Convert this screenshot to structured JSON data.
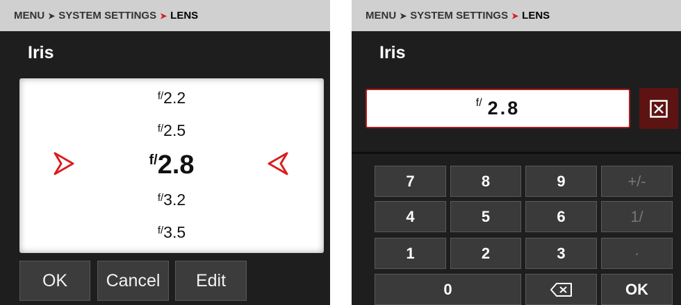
{
  "left": {
    "breadcrumb": {
      "menu": "MENU",
      "section": "SYSTEM SETTINGS",
      "current": "LENS"
    },
    "title": "Iris",
    "wheel": {
      "prefix": "f/",
      "items": [
        "2.2",
        "2.5",
        "2.8",
        "3.2",
        "3.5"
      ],
      "selected_index": 2
    },
    "buttons": {
      "ok": "OK",
      "cancel": "Cancel",
      "edit": "Edit"
    }
  },
  "right": {
    "breadcrumb": {
      "menu": "MENU",
      "section": "SYSTEM SETTINGS",
      "current": "LENS"
    },
    "title": "Iris",
    "field": {
      "prefix": "f/",
      "value": "2.8"
    },
    "clear_icon": "close-box-icon",
    "keypad": {
      "row1": [
        "7",
        "8",
        "9",
        "+/-"
      ],
      "row2": [
        "4",
        "5",
        "6",
        "1/"
      ],
      "row3": [
        "1",
        "2",
        "3",
        "·"
      ],
      "zero": "0",
      "backspace_icon": "backspace-icon",
      "ok": "OK"
    },
    "disabled_keys": [
      "+/-",
      "1/",
      "·"
    ]
  },
  "colors": {
    "panel_bg": "#1e1e1e",
    "header_bg": "#d0d0d0",
    "accent_red": "#d81e1e",
    "button_bg": "#3c3c3c",
    "clear_bg": "#5e1313"
  }
}
